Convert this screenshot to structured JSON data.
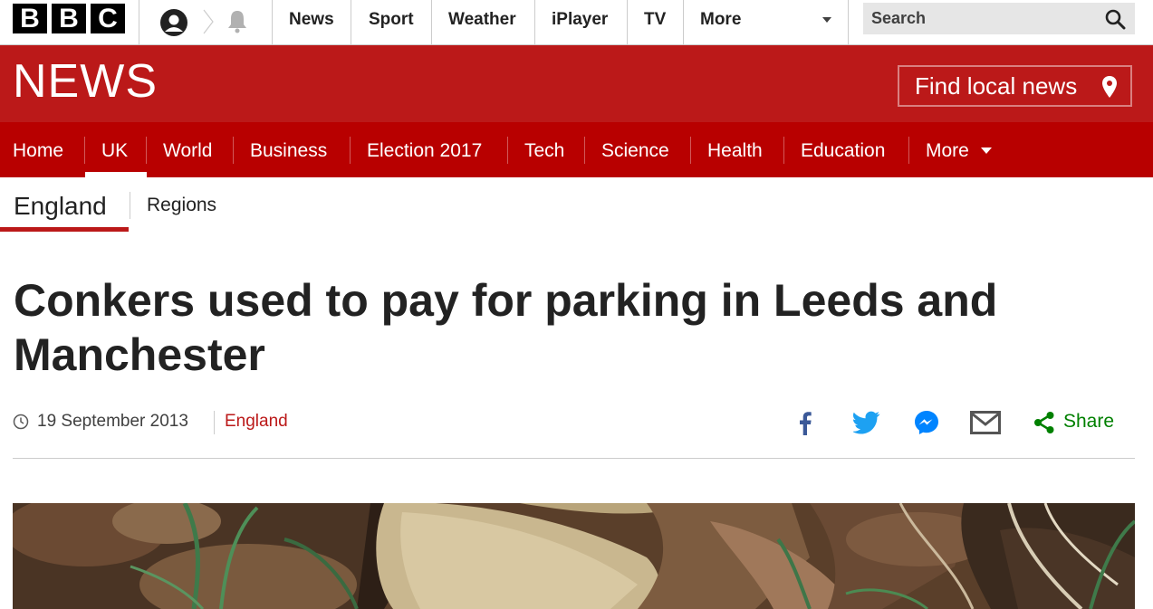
{
  "global_bar": {
    "logo_letters": [
      "B",
      "B",
      "C"
    ],
    "account_icon": "account-icon",
    "notifications_icon": "bell-icon",
    "nav": [
      "News",
      "Sport",
      "Weather",
      "iPlayer",
      "TV",
      "More"
    ],
    "search_placeholder": "Search"
  },
  "banner": {
    "logo_text": "NEWS",
    "find_local": "Find local news",
    "find_local_icon": "location-pin-icon",
    "color": "#bb1919"
  },
  "section_nav": {
    "items": [
      "Home",
      "UK",
      "World",
      "Business",
      "Election 2017",
      "Tech",
      "Science",
      "Health",
      "Education",
      "More"
    ],
    "active": "UK"
  },
  "sub_nav": {
    "items": [
      "England",
      "Regions"
    ],
    "active": "England"
  },
  "article": {
    "headline": "Conkers used to pay for parking in Leeds and Manchester",
    "date": "19 September 2013",
    "tag": "England",
    "share": {
      "icons": [
        "facebook-icon",
        "twitter-icon",
        "messenger-icon",
        "email-icon",
        "share-icon"
      ],
      "label": "Share",
      "label_color": "#008000"
    }
  }
}
